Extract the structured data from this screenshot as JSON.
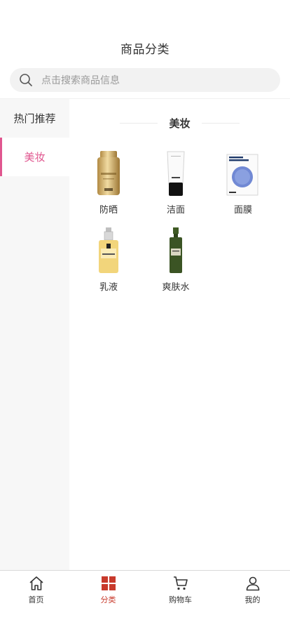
{
  "header": {
    "title": "商品分类"
  },
  "search": {
    "placeholder": "点击搜索商品信息"
  },
  "sidebar": {
    "items": [
      {
        "label": "热门推荐",
        "active": false
      },
      {
        "label": "美妆",
        "active": true
      }
    ],
    "accent": "#e0568f"
  },
  "content": {
    "section_title": "美妆",
    "products": [
      {
        "label": "防晒",
        "icon": "sunscreen-bottle"
      },
      {
        "label": "洁面",
        "icon": "cleanser-tube"
      },
      {
        "label": "面膜",
        "icon": "face-mask-pack"
      },
      {
        "label": "乳液",
        "icon": "lotion-bottle"
      },
      {
        "label": "爽肤水",
        "icon": "toner-bottle"
      }
    ]
  },
  "tabbar": {
    "active_color": "#c83a2c",
    "items": [
      {
        "label": "首页",
        "icon": "home-icon"
      },
      {
        "label": "分类",
        "icon": "category-icon",
        "active": true
      },
      {
        "label": "购物车",
        "icon": "cart-icon"
      },
      {
        "label": "我的",
        "icon": "user-icon"
      }
    ]
  }
}
